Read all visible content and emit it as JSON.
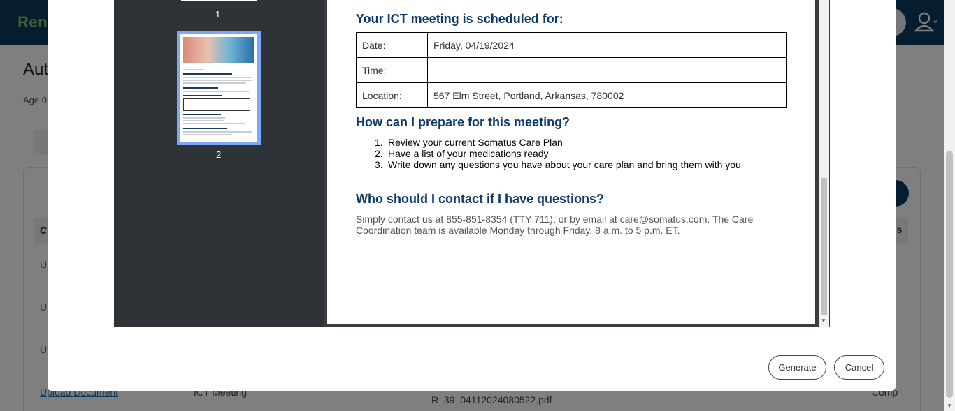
{
  "background": {
    "brand": "Ren",
    "page_title": "Aut",
    "page_sub": "Age 0",
    "table_head_first": "C",
    "status_head": "us",
    "row_link_letter": "U",
    "last_row": {
      "document": "Upload Document",
      "type": "ICT Meeting",
      "file": "R_39_04112024080522.pdf",
      "status": "Comp"
    }
  },
  "viewer": {
    "thumbnails": [
      {
        "number": "1"
      },
      {
        "number": "2"
      }
    ],
    "document": {
      "heading_scheduled": "Your ICT meeting is scheduled for:",
      "table": [
        {
          "label": "Date:",
          "value": "Friday, 04/19/2024"
        },
        {
          "label": "Time:",
          "value": ""
        },
        {
          "label": "Location:",
          "value": "567 Elm Street, Portland, Arkansas, 780002"
        }
      ],
      "heading_prepare": "How can I prepare for this meeting?",
      "prepare_steps": [
        {
          "num": "1.",
          "text": "Review your current Somatus Care Plan"
        },
        {
          "num": "2.",
          "text": "Have a list of your medications ready"
        },
        {
          "num": "3.",
          "text": "Write down any questions you have about your care plan and bring them with you"
        }
      ],
      "heading_contact": "Who should I contact if I have questions?",
      "contact_text": "Simply contact us at 855-851-8354 (TTY 711), or by email at care@somatus.com. The Care Coordination team is available Monday through Friday, 8 a.m. to 5 p.m. ET."
    }
  },
  "buttons": {
    "generate": "Generate",
    "cancel": "Cancel"
  },
  "colors": {
    "header_bg": "#0b3b5c",
    "brand_green": "#7fc16b",
    "doc_heading": "#0d3a6b",
    "thumb_selected": "#7ca8f5"
  }
}
